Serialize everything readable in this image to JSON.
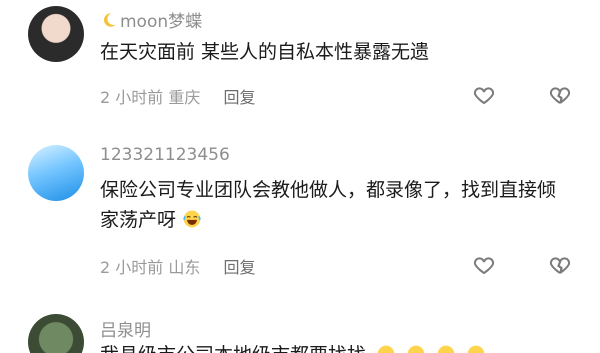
{
  "comments": [
    {
      "username": "moon梦蝶",
      "text": "在天灾面前  某些人的自私本性暴露无遗",
      "time_location": "2 小时前 重庆",
      "reply_label": "回复",
      "icons": [
        "moon-icon",
        "heart-icon",
        "broken-heart-icon"
      ]
    },
    {
      "username": "123321123456",
      "text": "保险公司专业团队会教他做人，都录像了，找到直接倾家荡产呀",
      "emoji": "laughing-emoji",
      "time_location": "2 小时前 山东",
      "reply_label": "回复",
      "icons": [
        "heart-icon",
        "broken-heart-icon"
      ]
    },
    {
      "username": "吕泉明",
      "text": "我县级市公司本地级市都要找找",
      "emoji": "laughing-emoji"
    }
  ]
}
